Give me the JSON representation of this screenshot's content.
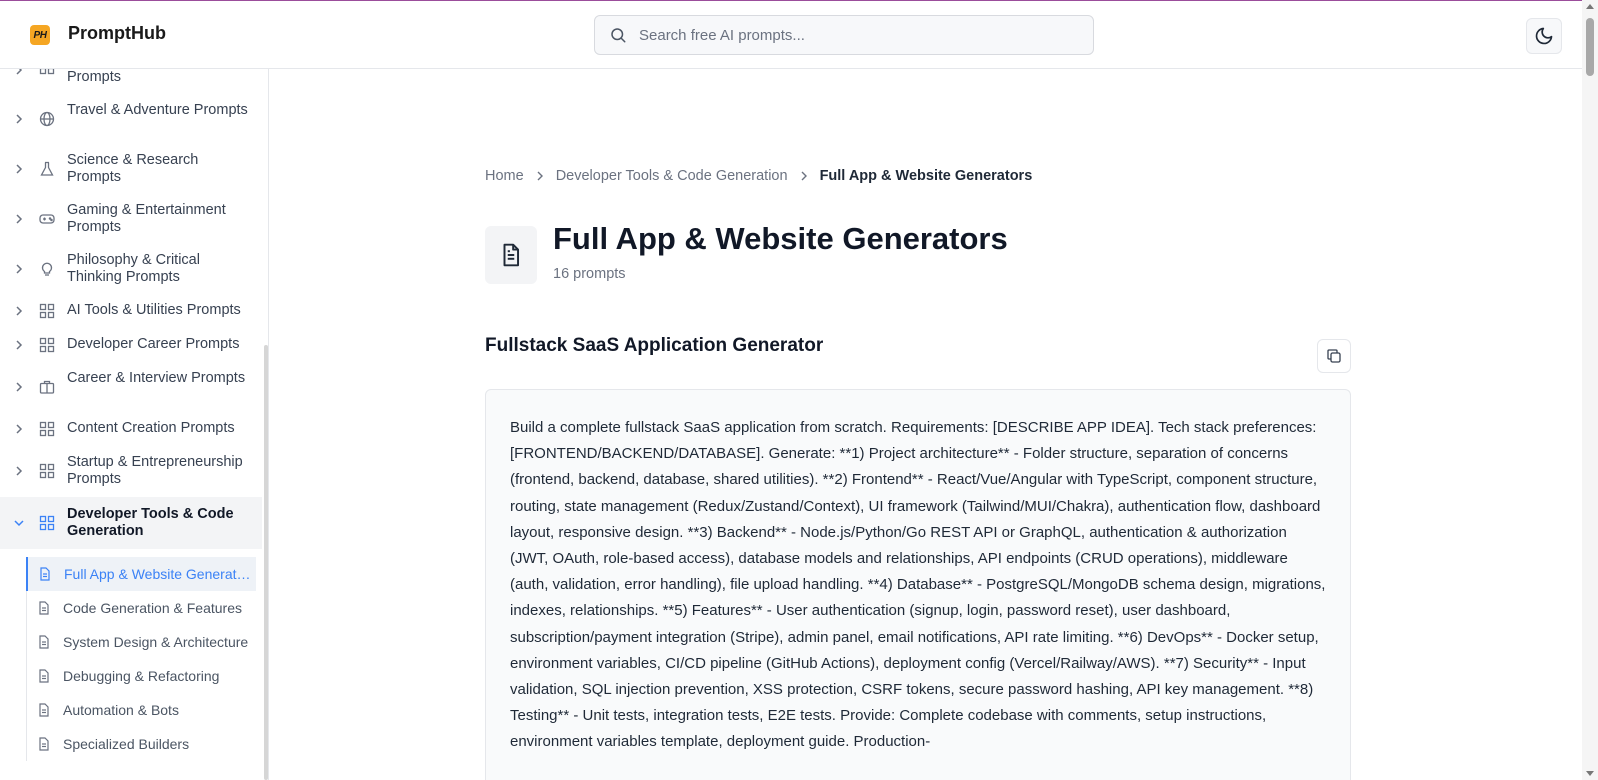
{
  "header": {
    "logo_text": "PH",
    "brand": "PromptHub",
    "search_placeholder": "Search free AI prompts...",
    "theme_toggle_icon": "moon-icon"
  },
  "sidebar": {
    "categories": [
      {
        "label": "Prompts",
        "icon": "grid-icon"
      },
      {
        "label": "Travel & Adventure Prompts",
        "icon": "globe-icon"
      },
      {
        "label": "Science & Research Prompts",
        "icon": "flask-icon"
      },
      {
        "label": "Gaming & Entertainment Prompts",
        "icon": "gamepad-icon"
      },
      {
        "label": "Philosophy & Critical Thinking Prompts",
        "icon": "lightbulb-icon"
      },
      {
        "label": "AI Tools & Utilities Prompts",
        "icon": "grid-icon"
      },
      {
        "label": "Developer Career Prompts",
        "icon": "grid-icon"
      },
      {
        "label": "Career & Interview Prompts",
        "icon": "briefcase-icon"
      },
      {
        "label": "Content Creation Prompts",
        "icon": "grid-icon"
      },
      {
        "label": "Startup & Entrepreneurship Prompts",
        "icon": "grid-icon"
      },
      {
        "label": "Developer Tools & Code Generation",
        "icon": "grid-icon"
      }
    ],
    "subitems": [
      {
        "label": "Full App & Website Generators"
      },
      {
        "label": "Code Generation & Features"
      },
      {
        "label": "System Design & Architecture"
      },
      {
        "label": "Debugging & Refactoring"
      },
      {
        "label": "Automation & Bots"
      },
      {
        "label": "Specialized Builders"
      }
    ]
  },
  "breadcrumb": {
    "home": "Home",
    "parent": "Developer Tools & Code Generation",
    "current": "Full App & Website Generators"
  },
  "page": {
    "title": "Full App & Website Generators",
    "count": "16 prompts"
  },
  "card": {
    "title": "Fullstack SaaS Application Generator",
    "text": "Build a complete fullstack SaaS application from scratch. Requirements: [DESCRIBE APP IDEA]. Tech stack preferences: [FRONTEND/BACKEND/DATABASE]. Generate: **1) Project architecture** - Folder structure, separation of concerns (frontend, backend, database, shared utilities). **2) Frontend** - React/Vue/Angular with TypeScript, component structure, routing, state management (Redux/Zustand/Context), UI framework (Tailwind/MUI/Chakra), authentication flow, dashboard layout, responsive design. **3) Backend** - Node.js/Python/Go REST API or GraphQL, authentication & authorization (JWT, OAuth, role-based access), database models and relationships, API endpoints (CRUD operations), middleware (auth, validation, error handling), file upload handling. **4) Database** - PostgreSQL/MongoDB schema design, migrations, indexes, relationships. **5) Features** - User authentication (signup, login, password reset), user dashboard, subscription/payment integration (Stripe), admin panel, email notifications, API rate limiting. **6) DevOps** - Docker setup, environment variables, CI/CD pipeline (GitHub Actions), deployment config (Vercel/Railway/AWS). **7) Security** - Input validation, SQL injection prevention, XSS protection, CSRF tokens, secure password hashing, API key management. **8) Testing** - Unit tests, integration tests, E2E tests. Provide: Complete codebase with comments, setup instructions, environment variables template, deployment guide. Production-"
  },
  "colors": {
    "accent": "#3b82f6",
    "logo": "#f5a623",
    "top_line": "#9b4d9b"
  }
}
